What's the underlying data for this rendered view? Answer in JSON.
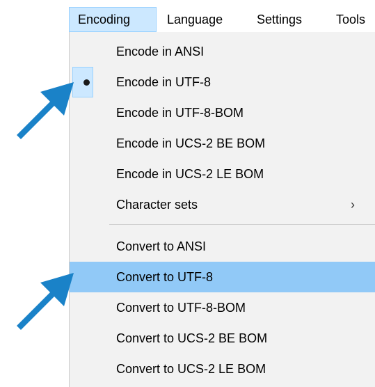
{
  "menubar": {
    "items": [
      {
        "label": "Encoding",
        "active": true
      },
      {
        "label": "Language"
      },
      {
        "label": "Settings"
      },
      {
        "label": "Tools"
      }
    ]
  },
  "encoding_menu": {
    "encode_items": [
      {
        "label": "Encode in ANSI"
      },
      {
        "label": "Encode in UTF-8",
        "checked": true
      },
      {
        "label": "Encode in UTF-8-BOM"
      },
      {
        "label": "Encode in UCS-2 BE BOM"
      },
      {
        "label": "Encode in UCS-2 LE BOM"
      },
      {
        "label": "Character sets",
        "submenu": true
      }
    ],
    "submenu_arrow": "›",
    "convert_items": [
      {
        "label": "Convert to ANSI"
      },
      {
        "label": "Convert to UTF-8",
        "highlighted": true
      },
      {
        "label": "Convert to UTF-8-BOM"
      },
      {
        "label": "Convert to UCS-2 BE BOM"
      },
      {
        "label": "Convert to UCS-2 LE BOM"
      }
    ]
  },
  "colors": {
    "highlight": "#91c9f7",
    "active_menubar": "#cce8ff",
    "arrow": "#1a82c8"
  },
  "icons": {
    "checked_item": "bullet-icon",
    "annotation": "pointer-arrow-icon"
  }
}
